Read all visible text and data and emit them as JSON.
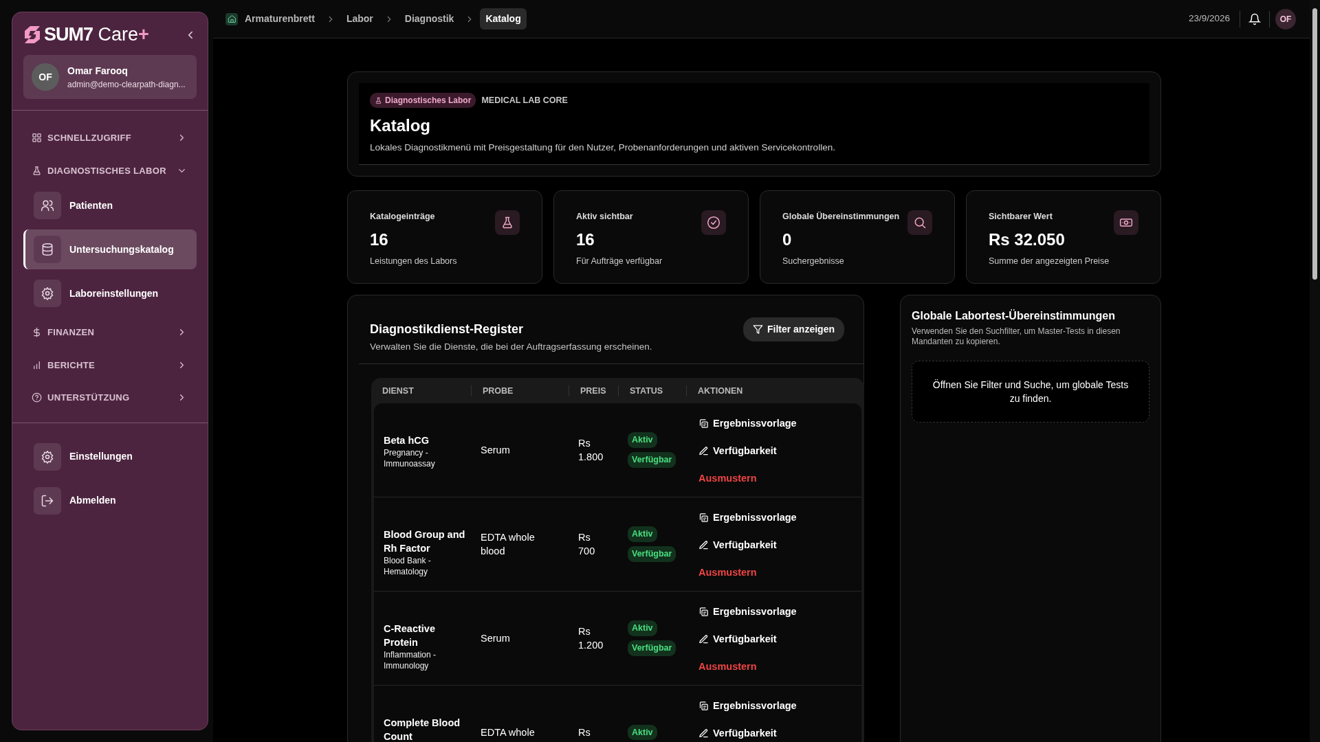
{
  "sidebar": {
    "brand": "SUM7",
    "product": " Care",
    "plus": "+",
    "user": {
      "initials": "OF",
      "name": "Omar Farooq",
      "email": "admin@demo-clearpath-diagn..."
    },
    "nav": [
      {
        "kind": "group",
        "label": "SCHNELLZUGRIFF",
        "expanded": false
      },
      {
        "kind": "group",
        "label": "DIAGNOSTISCHES LABOR",
        "expanded": true,
        "children": [
          {
            "label": "Patienten",
            "selected": false
          },
          {
            "label": "Untersuchungskatalog",
            "selected": true
          },
          {
            "label": "Laboreinstellungen",
            "selected": false
          }
        ]
      },
      {
        "kind": "group",
        "label": "FINANZEN",
        "expanded": false
      },
      {
        "kind": "group",
        "label": "BERICHTE",
        "expanded": false
      },
      {
        "kind": "group",
        "label": "UNTERSTÜTZUNG",
        "expanded": false
      }
    ],
    "footer": [
      {
        "label": "Einstellungen"
      },
      {
        "label": "Abmelden"
      }
    ]
  },
  "topbar": {
    "breadcrumbs": [
      {
        "label": "Armaturenbrett",
        "selected": false
      },
      {
        "label": "Labor",
        "selected": false
      },
      {
        "label": "Diagnostik",
        "selected": false
      },
      {
        "label": "Katalog",
        "selected": true
      }
    ],
    "date": "23/9/2026",
    "avatar": "OF"
  },
  "header": {
    "tag": "Diagnostisches Labor",
    "eyebrow": "MEDICAL LAB CORE",
    "title": "Katalog",
    "description": "Lokales Diagnostikmenü mit Preisgestaltung für den Nutzer, Probenanforderungen und aktiven Servicekontrollen."
  },
  "stats": [
    {
      "label": "Katalogeinträge",
      "value": "16",
      "caption": "Leistungen des Labors"
    },
    {
      "label": "Aktiv sichtbar",
      "value": "16",
      "caption": "Für Aufträge verfügbar"
    },
    {
      "label": "Globale Übereinstimmungen",
      "value": "0",
      "caption": "Suchergebnisse"
    },
    {
      "label": "Sichtbarer Wert",
      "value": "Rs 32.050",
      "caption": "Summe der angezeigten Preise"
    }
  ],
  "register": {
    "title": "Diagnostikdienst-Register",
    "subtitle": "Verwalten Sie die Dienste, die bei der Auftragserfassung erscheinen.",
    "filter_button": "Filter anzeigen",
    "columns": [
      "DIENST",
      "PROBE",
      "PREIS",
      "STATUS",
      "AKTIONEN"
    ],
    "rows": [
      {
        "name": "Beta hCG",
        "category": "Pregnancy - Immunoassay",
        "sample": "Serum",
        "price": "Rs 1.800",
        "statuses": [
          "Aktiv",
          "Verfügbar"
        ],
        "actions": [
          {
            "kind": "template",
            "label": "Ergebnissvorlage"
          },
          {
            "kind": "availability",
            "label": "Verfügbarkeit"
          },
          {
            "kind": "retire",
            "label": "Ausmustern"
          }
        ]
      },
      {
        "name": "Blood Group and Rh Factor",
        "category": "Blood Bank - Hematology",
        "sample": "EDTA whole blood",
        "price": "Rs 700",
        "statuses": [
          "Aktiv",
          "Verfügbar"
        ],
        "actions": [
          {
            "kind": "template",
            "label": "Ergebnissvorlage"
          },
          {
            "kind": "availability",
            "label": "Verfügbarkeit"
          },
          {
            "kind": "retire",
            "label": "Ausmustern"
          }
        ]
      },
      {
        "name": "C-Reactive Protein",
        "category": "Inflammation - Immunology",
        "sample": "Serum",
        "price": "Rs 1.200",
        "statuses": [
          "Aktiv",
          "Verfügbar"
        ],
        "actions": [
          {
            "kind": "template",
            "label": "Ergebnissvorlage"
          },
          {
            "kind": "availability",
            "label": "Verfügbarkeit"
          },
          {
            "kind": "retire",
            "label": "Ausmustern"
          }
        ]
      },
      {
        "name": "Complete Blood Count",
        "sample": "EDTA whole",
        "price": "Rs",
        "statuses": [
          "Aktiv"
        ],
        "actions": [
          {
            "kind": "template",
            "label": "Ergebnissvorlage"
          },
          {
            "kind": "availability",
            "label": "Verfügbarkeit"
          }
        ]
      }
    ]
  },
  "global": {
    "title": "Globale Labortest-Übereinstimmungen",
    "description": "Verwenden Sie den Suchfilter, um Master-Tests in diesen Mandanten zu kopieren.",
    "empty_text": "Öffnen Sie Filter und Suche, um globale Tests zu finden."
  }
}
